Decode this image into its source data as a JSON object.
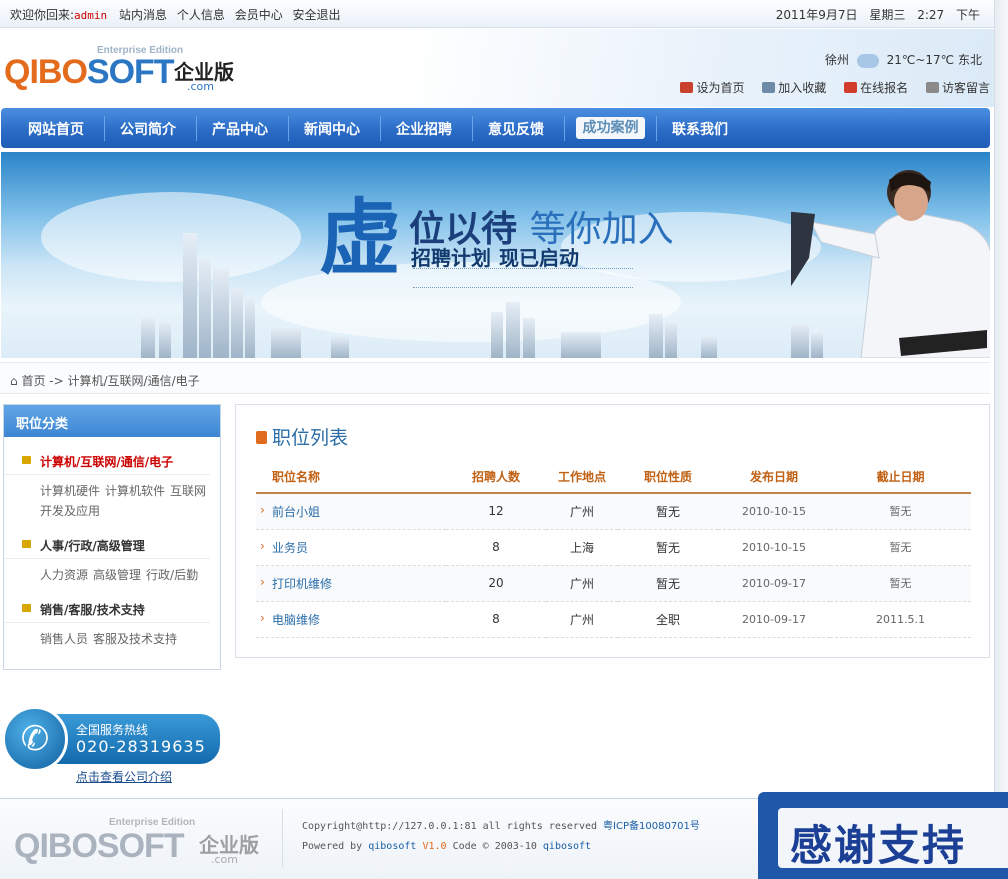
{
  "topbar": {
    "welcome": "欢迎你回来:",
    "username": "admin",
    "links": [
      "站内消息",
      "个人信息",
      "会员中心",
      "安全退出"
    ],
    "date": "2011年9月7日",
    "weekday": "星期三",
    "time": "2:27",
    "ampm": "下午"
  },
  "header": {
    "logo_edition": "Enterprise Edition",
    "logo_main_a": "QIBO",
    "logo_main_b": "SOFT",
    "logo_cn": "企业版",
    "logo_com": ".com",
    "weather_city": "徐州",
    "weather_temp": "21℃~17℃",
    "weather_wind": "东北",
    "quick_links": [
      "设为首页",
      "加入收藏",
      "在线报名",
      "访客留言"
    ]
  },
  "nav": {
    "items": [
      "网站首页",
      "公司简介",
      "产品中心",
      "新闻中心",
      "企业招聘",
      "意见反馈",
      "成功案例",
      "联系我们"
    ],
    "active": "成功案例"
  },
  "banner": {
    "big_char": "虚",
    "line1_a": "位以待",
    "line1_b": "等你加入",
    "line2_a": "招聘计划",
    "line2_b": "现已启动"
  },
  "breadcrumb": {
    "home": "首页",
    "arrow": "->",
    "current": "计算机/互联网/通信/电子"
  },
  "sidebar": {
    "title": "职位分类",
    "categories": [
      {
        "name": "计算机/互联网/通信/电子",
        "subs": [
          "计算机硬件",
          "计算机软件",
          "互联网开发及应用"
        ]
      },
      {
        "name": "人事/行政/高级管理",
        "subs": [
          "人力资源",
          "高级管理",
          "行政/后勤"
        ]
      },
      {
        "name": "销售/客服/技术支持",
        "subs": [
          "销售人员",
          "客服及技术支持"
        ]
      }
    ]
  },
  "jobs": {
    "title": "职位列表",
    "headers": [
      "职位名称",
      "招聘人数",
      "工作地点",
      "职位性质",
      "发布日期",
      "截止日期"
    ],
    "rows": [
      [
        "前台小姐",
        "12",
        "广州",
        "暂无",
        "2010-10-15",
        "暂无"
      ],
      [
        "业务员",
        "8",
        "上海",
        "暂无",
        "2010-10-15",
        "暂无"
      ],
      [
        "打印机维修",
        "20",
        "广州",
        "暂无",
        "2010-09-17",
        "暂无"
      ],
      [
        "电脑维修",
        "8",
        "广州",
        "全职",
        "2010-09-17",
        "2011.5.1"
      ]
    ]
  },
  "hotline": {
    "label": "全国服务热线",
    "number": "020-28319635",
    "link": "点击查看公司介绍"
  },
  "footer": {
    "copyright": "Copyright@http://127.0.0.1:81 all rights reserved",
    "icp": "粤ICP备10080701号",
    "powered_a": "Powered by",
    "powered_b": "qibosoft",
    "powered_v": "V1.0",
    "powered_c": "Code © 2003-10",
    "powered_d": "qibosoft",
    "thanks": "感谢支持"
  },
  "colors": {
    "nav_blue": "#2b6cc7",
    "link_blue": "#2a6ea9",
    "orange": "#e06a1e",
    "red": "#cc0000"
  }
}
